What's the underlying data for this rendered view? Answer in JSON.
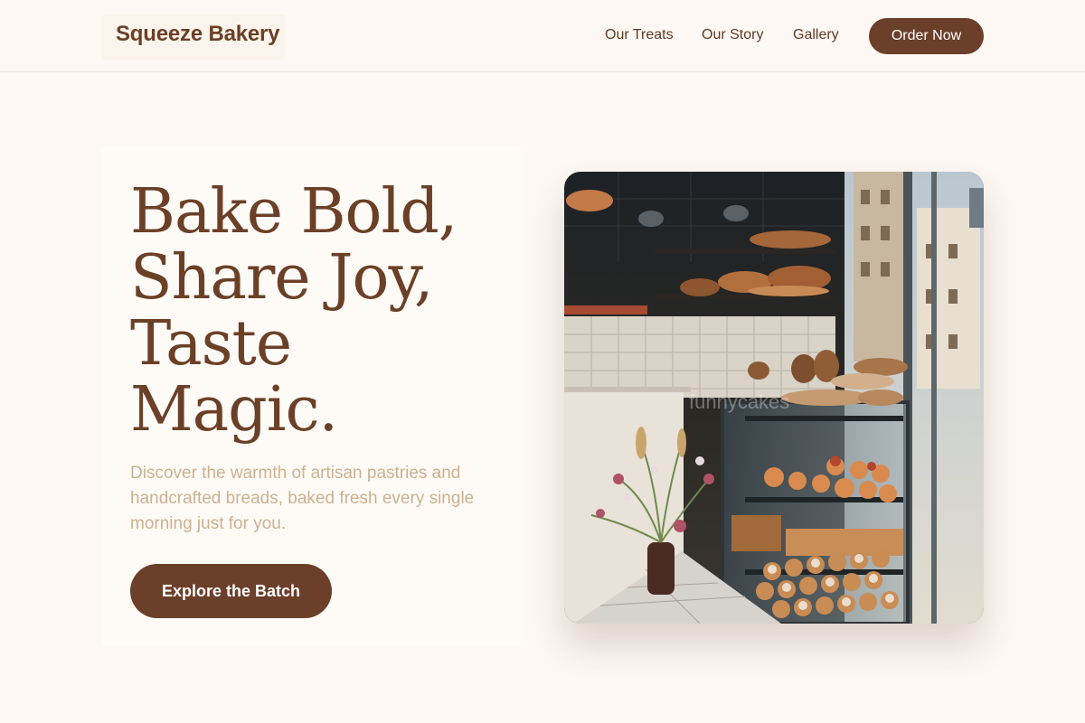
{
  "header": {
    "logo": "Squeeze Bakery",
    "nav": [
      {
        "label": "Our Treats"
      },
      {
        "label": "Our Story"
      },
      {
        "label": "Gallery"
      }
    ],
    "cta_label": "Order Now"
  },
  "hero": {
    "headline_lines": [
      "Bake Bold,",
      "Share Joy,",
      "Taste",
      "Magic."
    ],
    "subtext": "Discover the warmth of artisan pastries and handcrafted breads, baked fresh every single morning just for you.",
    "button_label": "Explore the Batch",
    "image_watermark": "funnycakes"
  },
  "colors": {
    "background": "#fdf8f3",
    "brand_brown": "#6b3f2a",
    "headline": "#6b4027",
    "subtext": "#cdb08f"
  }
}
